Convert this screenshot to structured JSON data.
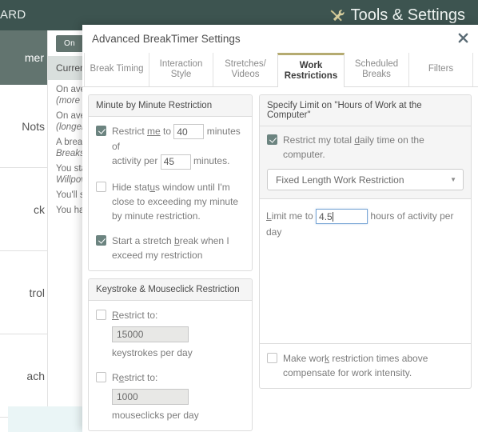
{
  "topbar": {
    "left_label": "ARD",
    "tools_label": "Tools & Settings",
    "tools_icon": "hammer-wrench-icon",
    "bg_color": "#3d5450",
    "accent_color": "#b5ab71"
  },
  "background": {
    "rail_head": "mer",
    "rail_items": [
      "Nots",
      "ck",
      "trol",
      "ach"
    ],
    "on_button": "On",
    "current_row": "Curren",
    "lines": [
      {
        "main": "On ave",
        "italic": "(more "
      },
      {
        "main": "On ave",
        "italic": "(longer"
      },
      {
        "main": "A breal",
        "italic": "Breaks"
      },
      {
        "main": "You sta",
        "italic": "Willpov"
      },
      {
        "main": "You'll s",
        "italic": ""
      },
      {
        "main": "You ha",
        "italic": ""
      }
    ]
  },
  "dialog": {
    "title": "Advanced BreakTimer Settings",
    "close_icon": "close-icon",
    "tabs": [
      {
        "label": "Break Timing",
        "active": false
      },
      {
        "label": "Interaction Style",
        "active": false
      },
      {
        "label": "Stretches/ Videos",
        "active": false
      },
      {
        "label": "Work Restrictions",
        "active": true
      },
      {
        "label": "Scheduled Breaks",
        "active": false
      },
      {
        "label": "Filters",
        "active": false
      }
    ]
  },
  "minute_panel": {
    "heading": "Minute by Minute Restriction",
    "restrict_me_pre": "Restrict ",
    "restrict_me_u": "me",
    "restrict_me_post": " to",
    "minutes_of": "minutes of",
    "activity_per": "activity per",
    "minutes_end": "minutes.",
    "minutes_value": "40",
    "per_value": "45",
    "restrict_checked": true,
    "hide_status_pre": "Hide stat",
    "hide_status_u": "u",
    "hide_status_post": "s window until I'm close to exceeding my minute by minute restriction.",
    "hide_status_checked": false,
    "stretch_pre": "Start a stretch ",
    "stretch_u": "b",
    "stretch_post": "reak when I exceed my restriction",
    "stretch_checked": true
  },
  "keystroke_panel": {
    "heading": "Keystroke & Mouseclick Restriction",
    "rows": [
      {
        "label_u": "R",
        "label_post": "estrict to:",
        "checked": false,
        "value": "15000",
        "unit": "keystrokes per day"
      },
      {
        "label_pre": "R",
        "label_u": "e",
        "label_post": "strict to:",
        "checked": false,
        "value": "1000",
        "unit": "mouseclicks per day"
      }
    ]
  },
  "hours_panel": {
    "heading": "Specify Limit on \"Hours of Work at the Computer\"",
    "restrict_daily_pre": "Restrict my total ",
    "restrict_daily_u": "d",
    "restrict_daily_post": "aily time on the computer.",
    "restrict_daily_checked": true,
    "mode_selected": "Fixed Length Work Restriction",
    "mode_caret": "chevron-down-icon",
    "limit_pre_u": "L",
    "limit_pre_post": "imit me to",
    "limit_value": "4.5",
    "limit_post": "hours of activity per day",
    "limit_focused": true,
    "compensate_pre": "Make wor",
    "compensate_u": "k",
    "compensate_post": " restriction times above compensate for work intensity.",
    "compensate_checked": false
  }
}
